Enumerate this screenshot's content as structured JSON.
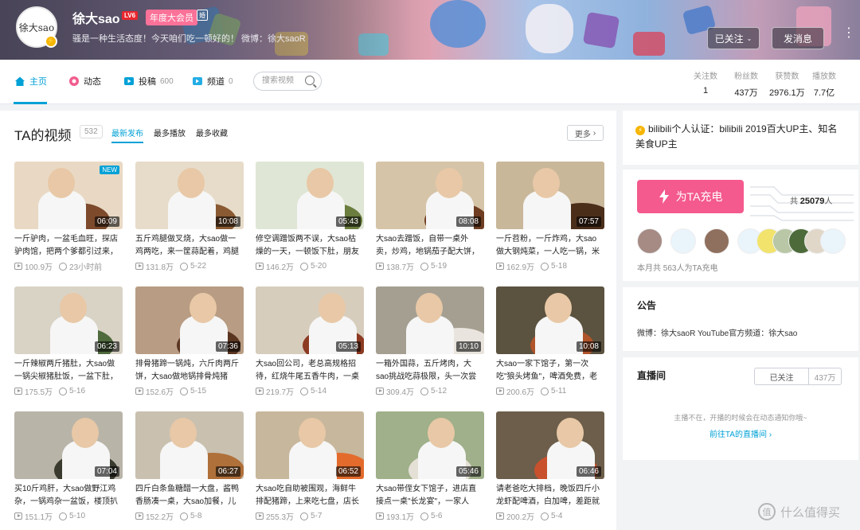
{
  "banner": {
    "avatar_text": "徐大sao",
    "username": "徐大sao",
    "level": "LV6",
    "vip_label": "年度大会员",
    "vip_mark": "婚",
    "signature": "骚是一种生活态度！今天咱们吃一顿好的！ 微博：徐大saoR",
    "followed_label": "已关注",
    "message_label": "发消息",
    "more_label": "⋮"
  },
  "nav": {
    "items": [
      {
        "label": "主页",
        "count": ""
      },
      {
        "label": "动态",
        "count": ""
      },
      {
        "label": "投稿",
        "count": "600"
      },
      {
        "label": "频道",
        "count": "0"
      }
    ],
    "search_placeholder": "搜索视频",
    "stats": [
      {
        "label": "关注数",
        "value": "1"
      },
      {
        "label": "粉丝数",
        "value": "437万"
      },
      {
        "label": "获赞数",
        "value": "2976.1万"
      },
      {
        "label": "播放数",
        "value": "7.7亿"
      }
    ]
  },
  "main": {
    "title": "TA的视频",
    "count": "532",
    "tabs": [
      "最新发布",
      "最多播放",
      "最多收藏"
    ],
    "more_label": "更多",
    "videos": [
      {
        "duration": "06:09",
        "title": "一斤驴肉，一盆毛血旺，探店驴肉馆，把两个爹都引过来，",
        "plays": "100.9万",
        "time": "23小时前",
        "new": "NEW"
      },
      {
        "duration": "10:08",
        "title": "五斤鸡腿做叉烧，大sao做一鸡两吃，来一筐蒜配着，鸡腿",
        "plays": "131.8万",
        "time": "5-22",
        "new": ""
      },
      {
        "duration": "05:43",
        "title": "修空调蹭饭两不误，大sao枯燥的一天，一顿饭下肚，朋友",
        "plays": "146.2万",
        "time": "5-20",
        "new": ""
      },
      {
        "duration": "08:08",
        "title": "大sao去蹭饭，自带一桌外卖，炒鸡，地锅茄子配大饼，",
        "plays": "138.7万",
        "time": "5-19",
        "new": ""
      },
      {
        "duration": "07:57",
        "title": "一斤苕粉，一斤炸鸡，大sao做大钢炖菜，一人吃一锅，米",
        "plays": "162.9万",
        "time": "5-18",
        "new": ""
      },
      {
        "duration": "06:23",
        "title": "一斤辣椒两斤猪肚，大sao做一锅尖椒猪肚饭，一盆下肚，",
        "plays": "175.5万",
        "time": "5-16",
        "new": ""
      },
      {
        "duration": "07:36",
        "title": "排骨猪蹄一锅炖，六斤肉两斤饼，大sao做地锅排骨炖猪",
        "plays": "152.6万",
        "time": "5-15",
        "new": ""
      },
      {
        "duration": "05:13",
        "title": "大sao回公司，老总高规格招待，红烧牛尾五香牛肉，一桌",
        "plays": "219.7万",
        "time": "5-14",
        "new": ""
      },
      {
        "duration": "10:10",
        "title": "一箱外国蒜，五斤烤肉，大sao挑战吃蒜极限，头一次尝",
        "plays": "309.4万",
        "time": "5-12",
        "new": ""
      },
      {
        "duration": "10:08",
        "title": "大sao一家下馆子，第一次吃\"狼头烤鱼\"，啤酒免费，老",
        "plays": "200.6万",
        "time": "5-11",
        "new": ""
      },
      {
        "duration": "07:04",
        "title": "买10斤鸡肝，大sao做野江鸡杂，一锅鸡杂一盆饭，楼顶扒",
        "plays": "151.1万",
        "time": "5-10",
        "new": ""
      },
      {
        "duration": "06:27",
        "title": "四斤白条鱼糖醋一大盘，酱鸭香肠凑一桌，大sao加餐，儿",
        "plays": "152.2万",
        "time": "5-8",
        "new": ""
      },
      {
        "duration": "06:52",
        "title": "大sao吃自助被围观，海鲜牛排配猪蹄，上来吃七盘，店长",
        "plays": "255.3万",
        "time": "5-7",
        "new": ""
      },
      {
        "duration": "05:46",
        "title": "大sao带侄女下馆子，进店直接点一桌\"长龙宴\"，一家人",
        "plays": "193.1万",
        "time": "5-6",
        "new": ""
      },
      {
        "duration": "06:46",
        "title": "请老爸吃大排档，晚饭四斤小龙虾配啤酒，白加啤，差距就",
        "plays": "200.2万",
        "time": "5-4",
        "new": ""
      }
    ]
  },
  "side": {
    "cert_text": "bilibili个人认证：bilibili 2019百大UP主、知名美食UP主",
    "charge_label": "为TA充电",
    "charge_total_prefix": "共",
    "charge_total_value": "25079",
    "charge_total_suffix": "人",
    "charge_month": "本月共 563人为TA充电",
    "notice_title": "公告",
    "notice_text": "微博：徐大saoR YouTube官方频道：徐大sao",
    "live_title": "直播间",
    "live_followed": "已关注",
    "live_count": "437万",
    "live_msg": "主播不在，开播的时候会在动态通知你哦~",
    "live_link": "前往TA的直播间 ›"
  },
  "watermark": {
    "icon": "值",
    "text": "什么值得买"
  },
  "colors": {
    "accent": "#00a1d6",
    "pink": "#f45a8d",
    "vip": "#fb7299"
  }
}
